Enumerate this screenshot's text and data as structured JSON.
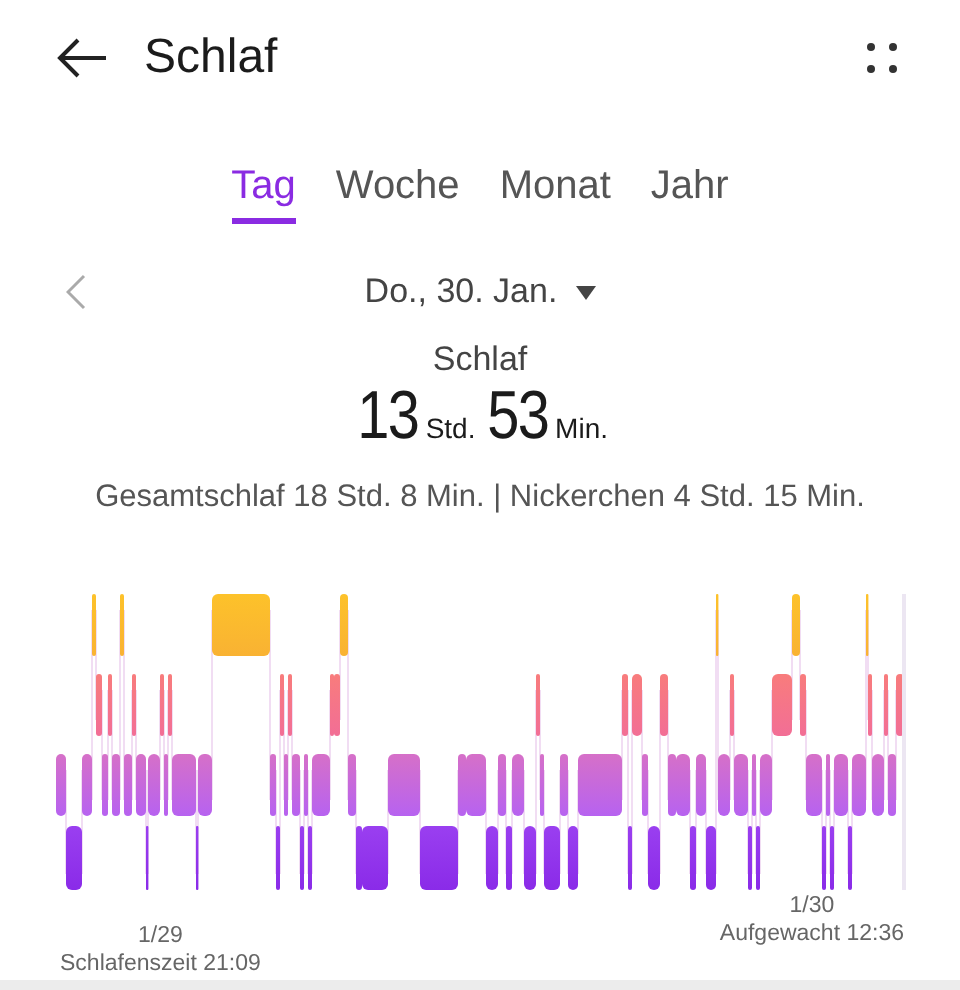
{
  "header": {
    "title": "Schlaf"
  },
  "tabs": [
    {
      "label": "Tag",
      "selected": true
    },
    {
      "label": "Woche",
      "selected": false
    },
    {
      "label": "Monat",
      "selected": false
    },
    {
      "label": "Jahr",
      "selected": false
    }
  ],
  "date": "Do., 30. Jan.",
  "summary": {
    "label": "Schlaf",
    "hours": "13",
    "hours_unit": "Std.",
    "minutes": "53",
    "minutes_unit": "Min.",
    "details": "Gesamtschlaf 18 Std. 8 Min. | Nickerchen 4 Std. 15 Min."
  },
  "chart": {
    "start_date": "1/29",
    "start_label": "Schlafenszeit 21:09",
    "end_date": "1/30",
    "end_label": "Aufgewacht 12:36"
  }
}
